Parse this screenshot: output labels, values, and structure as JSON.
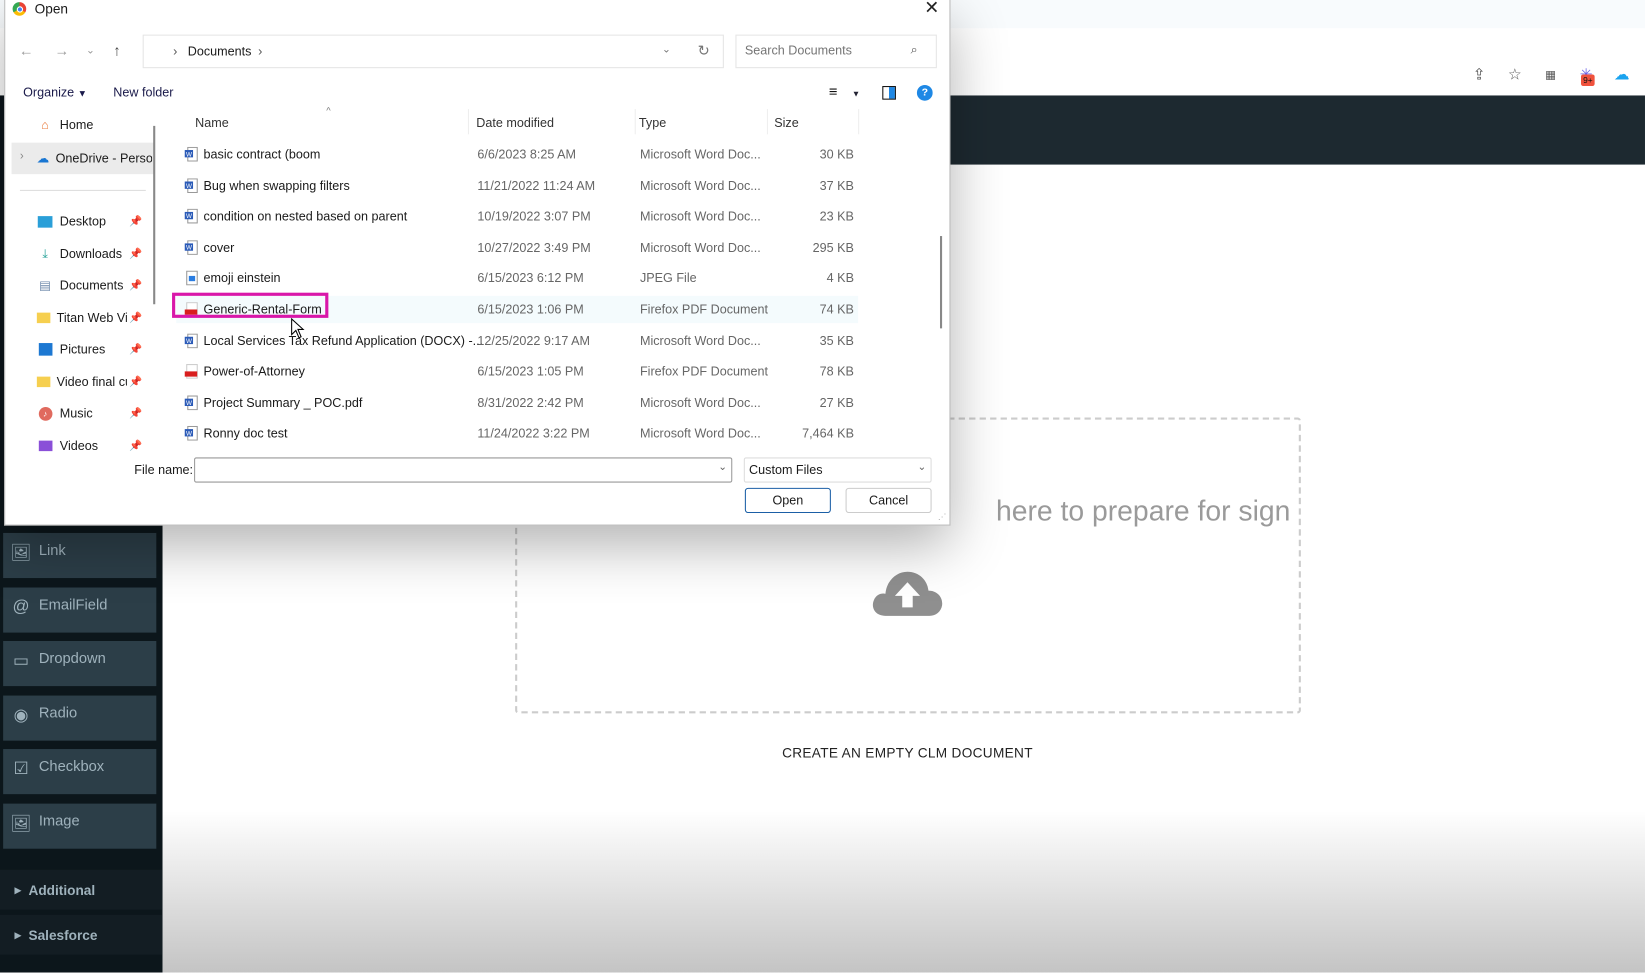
{
  "browser": {
    "extension_badge": "9+",
    "icons": [
      "share-icon",
      "star-icon",
      "qr-icon",
      "extension-sparkle-icon",
      "cloud-extension-icon",
      "profile-icon"
    ]
  },
  "app": {
    "sidebar_tools": [
      {
        "label": "Link",
        "icon": "image-icon"
      },
      {
        "label": "EmailField",
        "icon": "at-icon"
      },
      {
        "label": "Dropdown",
        "icon": "dropdown-icon"
      },
      {
        "label": "Radio",
        "icon": "radio-icon"
      },
      {
        "label": "Checkbox",
        "icon": "checkbox-icon"
      },
      {
        "label": "Image",
        "icon": "image-icon"
      }
    ],
    "sections": [
      "Additional",
      "Salesforce"
    ],
    "drop_text": "here to prepare for sign",
    "create_empty": "CREATE AN EMPTY CLM DOCUMENT"
  },
  "dialog": {
    "title": "Open",
    "breadcrumb": [
      "Documents"
    ],
    "search_placeholder": "Search Documents",
    "organize": "Organize",
    "new_folder": "New folder",
    "nav": [
      {
        "label": "Home",
        "icon": "home-icon",
        "pinned": false
      },
      {
        "label": "OneDrive - Personal",
        "icon": "onedrive-icon",
        "pinned": false
      },
      {
        "label": "Desktop",
        "icon": "desktop-icon",
        "pinned": true
      },
      {
        "label": "Downloads",
        "icon": "download-icon",
        "pinned": true
      },
      {
        "label": "Documents",
        "icon": "documents-icon",
        "pinned": true
      },
      {
        "label": "Titan Web Vi...",
        "icon": "folder-icon",
        "pinned": true
      },
      {
        "label": "Pictures",
        "icon": "pictures-icon",
        "pinned": true
      },
      {
        "label": "Video final cu...",
        "icon": "folder-icon",
        "pinned": true
      },
      {
        "label": "Music",
        "icon": "music-icon",
        "pinned": true
      },
      {
        "label": "Videos",
        "icon": "videos-icon",
        "pinned": true
      }
    ],
    "columns": {
      "name": "Name",
      "date": "Date modified",
      "type": "Type",
      "size": "Size"
    },
    "files": [
      {
        "name": "basic contract (boom",
        "date": "6/6/2023 8:25 AM",
        "type": "Microsoft Word Doc...",
        "size": "30 KB",
        "kind": "word"
      },
      {
        "name": "Bug when swapping filters",
        "date": "11/21/2022 11:24 AM",
        "type": "Microsoft Word Doc...",
        "size": "37 KB",
        "kind": "word"
      },
      {
        "name": "condition on nested based on parent",
        "date": "10/19/2022 3:07 PM",
        "type": "Microsoft Word Doc...",
        "size": "23 KB",
        "kind": "word"
      },
      {
        "name": "cover",
        "date": "10/27/2022 3:49 PM",
        "type": "Microsoft Word Doc...",
        "size": "295 KB",
        "kind": "word"
      },
      {
        "name": "emoji einstein",
        "date": "6/15/2023 6:12 PM",
        "type": "JPEG File",
        "size": "4 KB",
        "kind": "jpeg"
      },
      {
        "name": "Generic-Rental-Form",
        "date": "6/15/2023 1:06 PM",
        "type": "Firefox PDF Document",
        "size": "74 KB",
        "kind": "pdf",
        "highlighted": true
      },
      {
        "name": "Local Services Tax Refund Application (DOCX) -...",
        "date": "12/25/2022 9:17 AM",
        "type": "Microsoft Word Doc...",
        "size": "35 KB",
        "kind": "word"
      },
      {
        "name": "Power-of-Attorney",
        "date": "6/15/2023 1:05 PM",
        "type": "Firefox PDF Document",
        "size": "78 KB",
        "kind": "pdf"
      },
      {
        "name": "Project Summary _ POC.pdf",
        "date": "8/31/2022 2:42 PM",
        "type": "Microsoft Word Doc...",
        "size": "27 KB",
        "kind": "word"
      },
      {
        "name": "Ronny doc test",
        "date": "11/24/2022 3:22 PM",
        "type": "Microsoft Word Doc...",
        "size": "7,464 KB",
        "kind": "word"
      }
    ],
    "file_name_label": "File name:",
    "file_name_value": "",
    "file_type": "Custom Files",
    "open_label": "Open",
    "cancel_label": "Cancel"
  },
  "colors": {
    "highlight": "#d917a9",
    "sidebar": "#0c161b",
    "header": "#1d2930",
    "tool_bg": "#2c3e48"
  }
}
